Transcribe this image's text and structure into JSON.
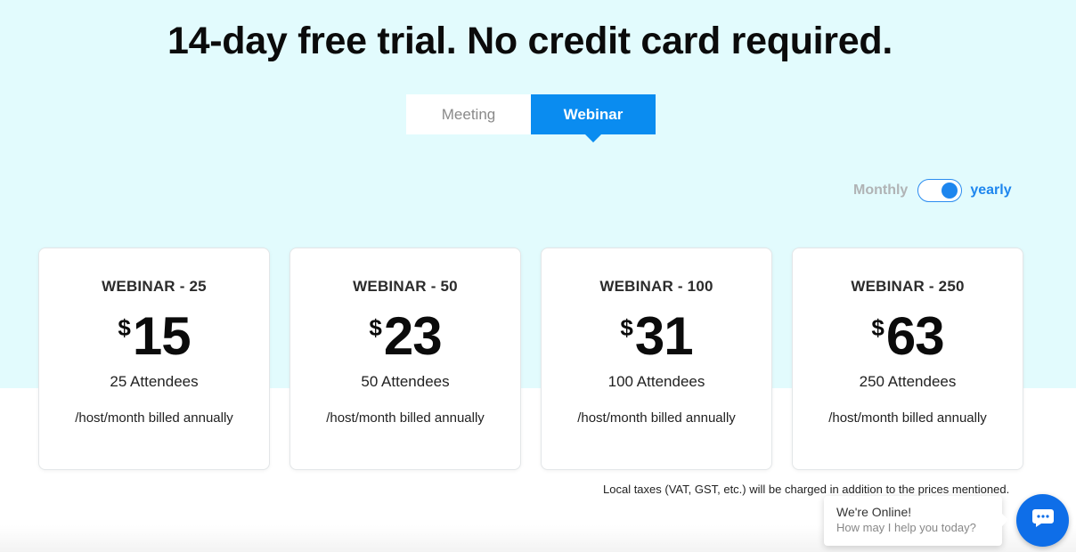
{
  "headline": "14-day free trial. No credit card required.",
  "tabs": [
    {
      "label": "Meeting",
      "active": false
    },
    {
      "label": "Webinar",
      "active": true
    }
  ],
  "billing": {
    "monthly_label": "Monthly",
    "yearly_label": "yearly",
    "selected": "yearly"
  },
  "plans": [
    {
      "name": "WEBINAR - 25",
      "currency": "$",
      "price": "15",
      "attendees": "25 Attendees",
      "billing_note": "/host/month billed annually"
    },
    {
      "name": "WEBINAR - 50",
      "currency": "$",
      "price": "23",
      "attendees": "50 Attendees",
      "billing_note": "/host/month billed annually"
    },
    {
      "name": "WEBINAR - 100",
      "currency": "$",
      "price": "31",
      "attendees": "100 Attendees",
      "billing_note": "/host/month billed annually"
    },
    {
      "name": "WEBINAR - 250",
      "currency": "$",
      "price": "63",
      "attendees": "250 Attendees",
      "billing_note": "/host/month billed annually"
    }
  ],
  "tax_note": "Local taxes (VAT, GST, etc.) will be charged in addition to the prices mentioned.",
  "chat": {
    "title": "We're Online!",
    "subtitle": "How may I help you today?",
    "icon": "chat-icon"
  },
  "colors": {
    "hero_background": "#e2fbfd",
    "accent": "#0a8cf0",
    "toggle": "#1e86ee",
    "chat_button": "#0e6ee8"
  }
}
